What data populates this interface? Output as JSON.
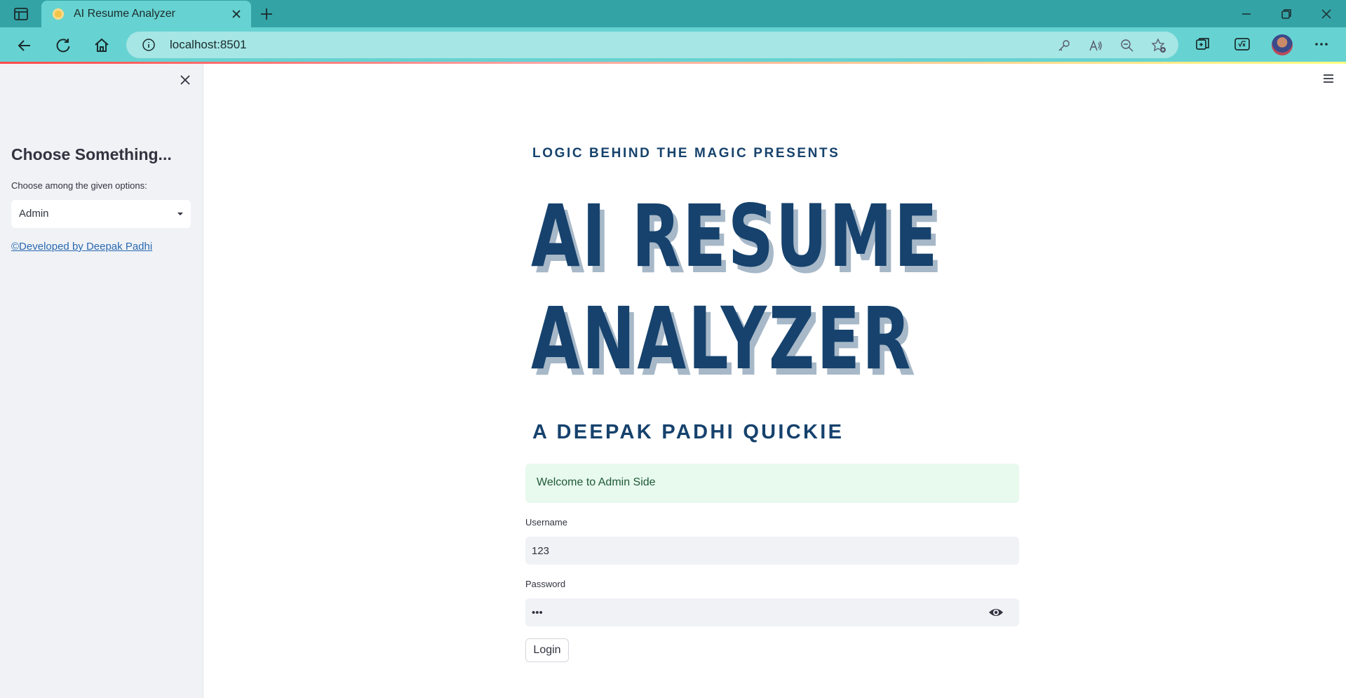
{
  "browser": {
    "tab_title": "AI Resume Analyzer",
    "url": "localhost:8501",
    "icons": {
      "tab_actions": "sidebar-toggle-icon",
      "tab_close": "close-icon",
      "new_tab": "plus-icon",
      "minimize": "minimize-icon",
      "restore": "restore-icon",
      "close_window": "close-icon",
      "back": "back-arrow-icon",
      "refresh": "refresh-icon",
      "home": "home-icon",
      "site_info": "info-icon",
      "password": "key-icon",
      "read_aloud": "read-aloud-icon",
      "zoom": "zoom-out-icon",
      "favorites": "add-favorite-icon",
      "collections": "collections-icon",
      "math_solver": "math-solver-icon",
      "profile": "avatar",
      "more": "more-icon"
    },
    "colors": {
      "tabbar": "#34a3a6",
      "toolbar": "#66d3d2",
      "url_box": "#a6e6e5"
    }
  },
  "sidebar": {
    "heading": "Choose Something...",
    "select_label": "Choose among the given options:",
    "select_value": "Admin",
    "footer_link": "©Developed by Deepak Padhi"
  },
  "main": {
    "presents": "LOGIC BEHIND THE MAGIC PRESENTS",
    "title_line1": "AI RESUME",
    "title_line2": "ANALYZER",
    "subtitle": "A DEEPAK PADHI QUICKIE",
    "alert": "Welcome to Admin Side",
    "username_label": "Username",
    "username_value": "123",
    "password_label": "Password",
    "password_value": "•••",
    "login_label": "Login",
    "colors": {
      "title": "#16426d",
      "title_shadow": "#a7b8c8",
      "alert_bg": "#e8f9ee"
    }
  }
}
